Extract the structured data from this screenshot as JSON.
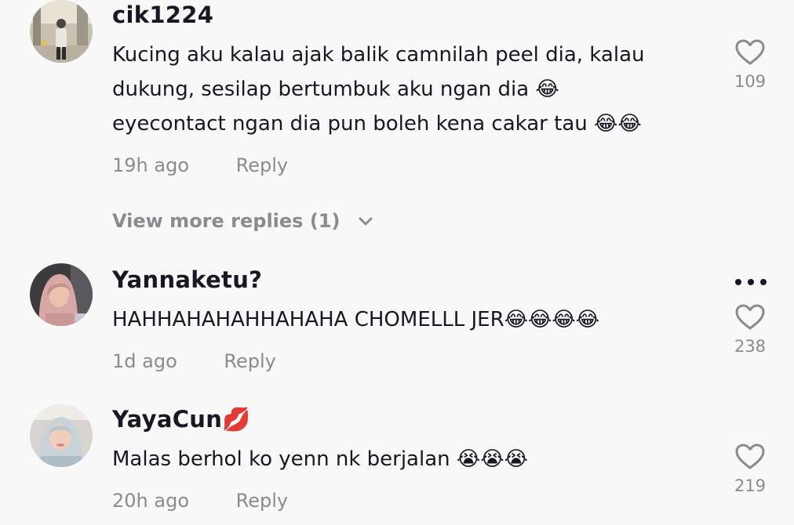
{
  "comments": [
    {
      "username": "cik1224",
      "text_lines": [
        "Kucing aku kalau ajak balik camnilah peel dia, kalau",
        "dukung, sesilap bertumbuk aku ngan dia 😂",
        "eyecontact ngan dia pun boleh kena cakar tau 😂😂"
      ],
      "time": "19h ago",
      "reply_label": "Reply",
      "likes": "109",
      "avatar_icon": "person-photo-icon"
    },
    {
      "username": "Yannaketu?",
      "text_lines": [
        "HAHHAHAHAHHAHAHA CHOMELLL JER😂😂😂😂"
      ],
      "time": "1d ago",
      "reply_label": "Reply",
      "likes": "238",
      "avatar_icon": "person-photo-icon"
    },
    {
      "username": "YayaCun💋",
      "text_lines": [
        "Malas berhol ko yenn nk berjalan 😭😭😭"
      ],
      "time": "20h ago",
      "reply_label": "Reply",
      "likes": "219",
      "avatar_icon": "person-photo-icon"
    }
  ],
  "view_more_replies": "View more replies (1)",
  "icons": {
    "like": "heart-outline-icon",
    "more": "more-dots-icon",
    "expand": "chevron-down-icon"
  },
  "colors": {
    "background": "#f8f8f8",
    "text": "#161823",
    "secondary": "#8a8b91"
  }
}
